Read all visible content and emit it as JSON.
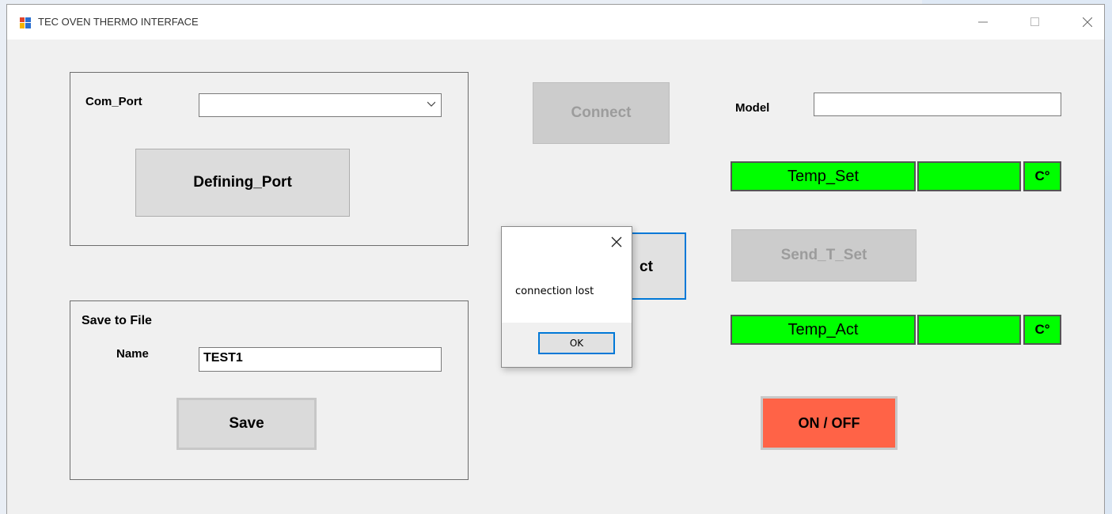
{
  "window": {
    "title": "TEC OVEN THERMO INTERFACE",
    "controls": {
      "minimize": "minimize-icon",
      "maximize": "maximize-icon",
      "close": "close-icon"
    }
  },
  "port_group": {
    "com_port_label": "Com_Port",
    "com_port_value": "",
    "define_button": "Defining_Port"
  },
  "save_group": {
    "title": "Save to File",
    "name_label": "Name",
    "name_value": "TEST1",
    "save_button": "Save"
  },
  "connection": {
    "connect_button": "Connect",
    "hidden_button_partial": "ct"
  },
  "right_panel": {
    "model_label": "Model",
    "model_value": "",
    "temp_set_label": "Temp_Set",
    "temp_set_value": "",
    "temp_set_unit": "C°",
    "send_button": "Send_T_Set",
    "temp_act_label": "Temp_Act",
    "temp_act_value": "",
    "temp_act_unit": "C°",
    "onoff_button": "ON / OFF"
  },
  "dialog": {
    "message": "connection lost",
    "ok_button": "OK"
  },
  "colors": {
    "green_indicator": "#00ff00",
    "onoff_red": "#ff6347",
    "focus_blue": "#0078d7"
  }
}
